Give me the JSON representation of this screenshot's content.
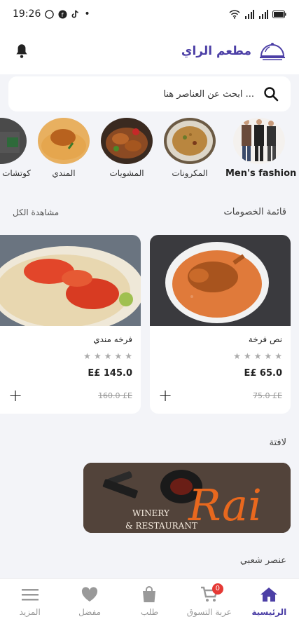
{
  "status_bar": {
    "time": "19:26",
    "dot": "•"
  },
  "header": {
    "title": "مطعم الراي"
  },
  "search": {
    "placeholder": "ابحث عن العناصر هنا ..."
  },
  "categories": [
    {
      "label": "Men's fashion",
      "bold": true
    },
    {
      "label": "المكرونات"
    },
    {
      "label": "المشويات"
    },
    {
      "label": "المندي"
    },
    {
      "label": "كوتشات"
    }
  ],
  "discounts": {
    "title": "قائمة الخصومات",
    "see_all": "مشاهدة الكل",
    "items": [
      {
        "name": "نص فرخة",
        "price": "65.0 £E",
        "old_price": "75.0 £E",
        "rating": 0
      },
      {
        "name": "فرخه مندي",
        "price": "145.0 £E",
        "old_price": "160.0 £E",
        "rating": 0
      }
    ]
  },
  "banner_section": {
    "title": "لافتة"
  },
  "banner": {
    "line1": "WINERY",
    "line2": "& RESTAURANT",
    "logo": "Rai"
  },
  "popular_section": {
    "title": "عنصر شعبي"
  },
  "bottom_nav": {
    "home": "الرئيسية",
    "cart": "عربة التسوق",
    "cart_count": "0",
    "orders": "طلب",
    "favorites": "مفضل",
    "more": "المزيد"
  },
  "colors": {
    "accent": "#4c3fa6",
    "badge": "#e53935"
  }
}
